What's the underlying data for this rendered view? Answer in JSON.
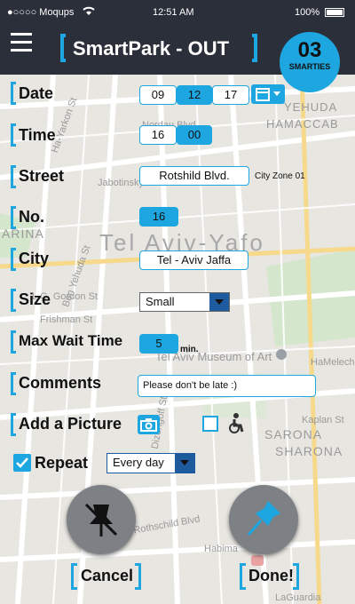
{
  "status": {
    "carrier": "●○○○○ Moqups",
    "time": "12:51 AM",
    "battery": "100%"
  },
  "header": {
    "title": "SmartPark - OUT",
    "smarties_count": "03",
    "smarties_label": "SMARTIES"
  },
  "map": {
    "city_label": "Tel Aviv-Yafo",
    "labels": [
      "Ha-Yarkon St",
      "Ben Yehuda St",
      "Jabotinsky St",
      "L.G. Gordon St",
      "Frishman St",
      "Dizengoff St",
      "Tel Aviv Museum of Art",
      "HaMelech",
      "Kaplan St",
      "SARONA",
      "SHARONA",
      "LaGuardia",
      "YEHUDA",
      "HAMACCAB",
      "ARINA",
      "Rothschild Blvd",
      "Nordau Blvd",
      "Habima"
    ]
  },
  "form": {
    "date_label": "Date",
    "date_day": "09",
    "date_month": "12",
    "date_year": "17",
    "time_label": "Time",
    "time_hour": "16",
    "time_min": "00",
    "street_label": "Street",
    "street_value": "Rotshild Blvd.",
    "street_zone": "City Zone 01",
    "no_label": "No.",
    "no_value": "16",
    "city_label": "City",
    "city_value": "Tel - Aviv Jaffa",
    "size_label": "Size",
    "size_value": "Small",
    "maxwait_label": "Max Wait Time",
    "maxwait_value": "5",
    "maxwait_unit": "min.",
    "comments_label": "Comments",
    "comments_value": "Please don't be late :)",
    "picture_label": "Add a Picture",
    "repeat_label": "Repeat",
    "repeat_value": "Every day"
  },
  "actions": {
    "cancel_label": "Cancel",
    "done_label": "Done!"
  },
  "colors": {
    "accent": "#1ea6e0",
    "bar": "#2b2f3a"
  }
}
